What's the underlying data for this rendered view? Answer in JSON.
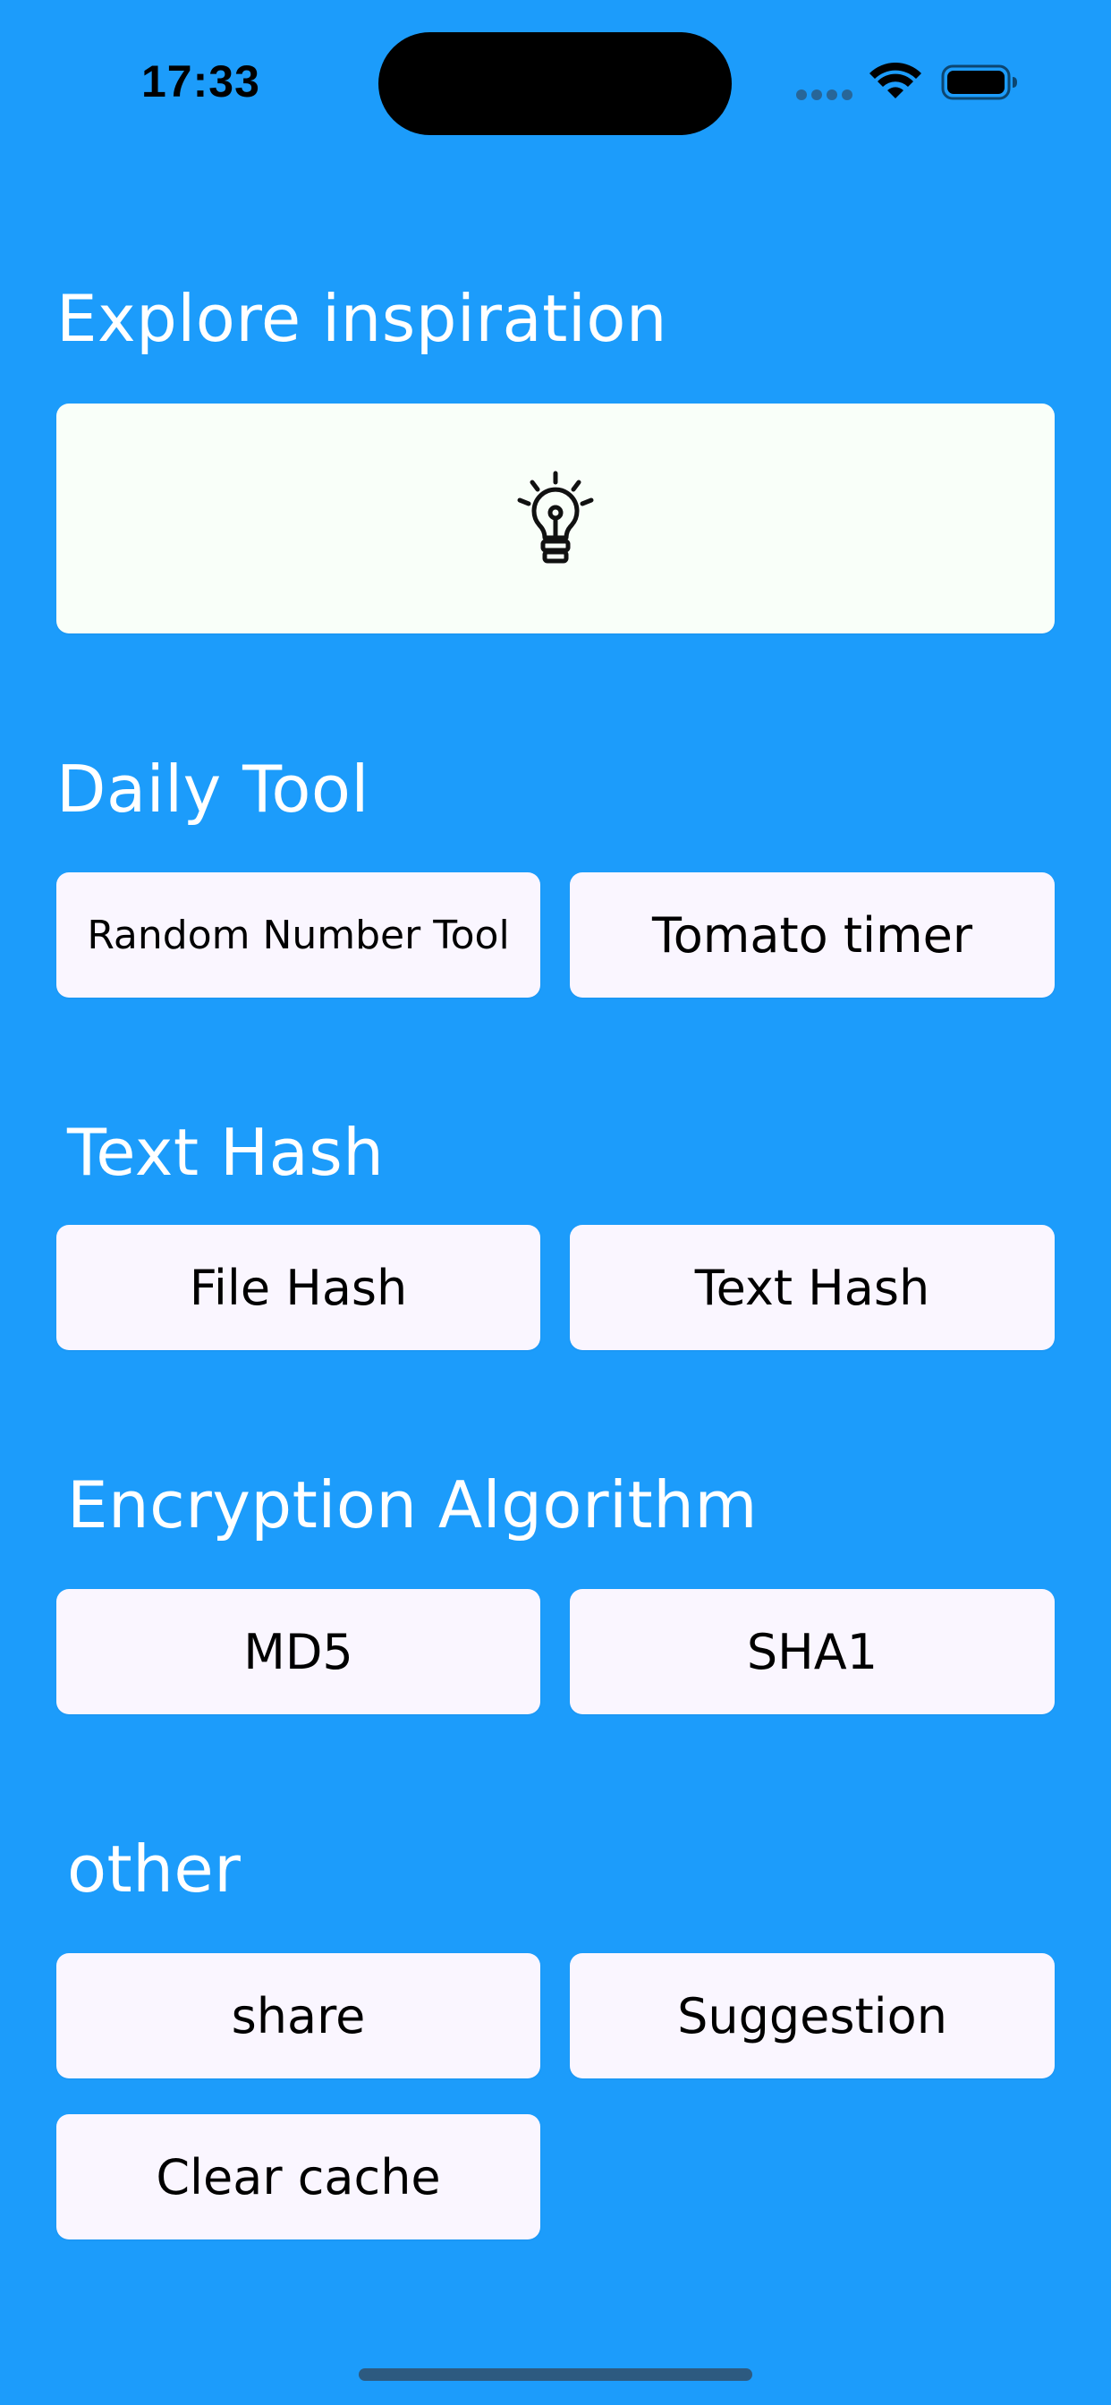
{
  "status_bar": {
    "time": "17:33",
    "icons": [
      "cellular-signal-icon",
      "wifi-icon",
      "battery-icon"
    ]
  },
  "sections": {
    "explore": {
      "title": "Explore inspiration",
      "icon": "lightbulb-icon"
    },
    "daily_tool": {
      "title": "Daily Tool",
      "buttons": [
        "Random Number Tool",
        "Tomato timer"
      ]
    },
    "text_hash": {
      "title": "Text Hash",
      "buttons": [
        "File Hash",
        "Text Hash"
      ]
    },
    "encryption": {
      "title": "Encryption Algorithm",
      "buttons": [
        "MD5",
        "SHA1"
      ]
    },
    "other": {
      "title": "other",
      "buttons": [
        "share",
        "Suggestion",
        "Clear cache"
      ]
    }
  },
  "colors": {
    "background": "#1c9cfb",
    "button": "#faf6ff",
    "inspiration_card": "#f9fff9",
    "title_text": "#ffffff"
  }
}
